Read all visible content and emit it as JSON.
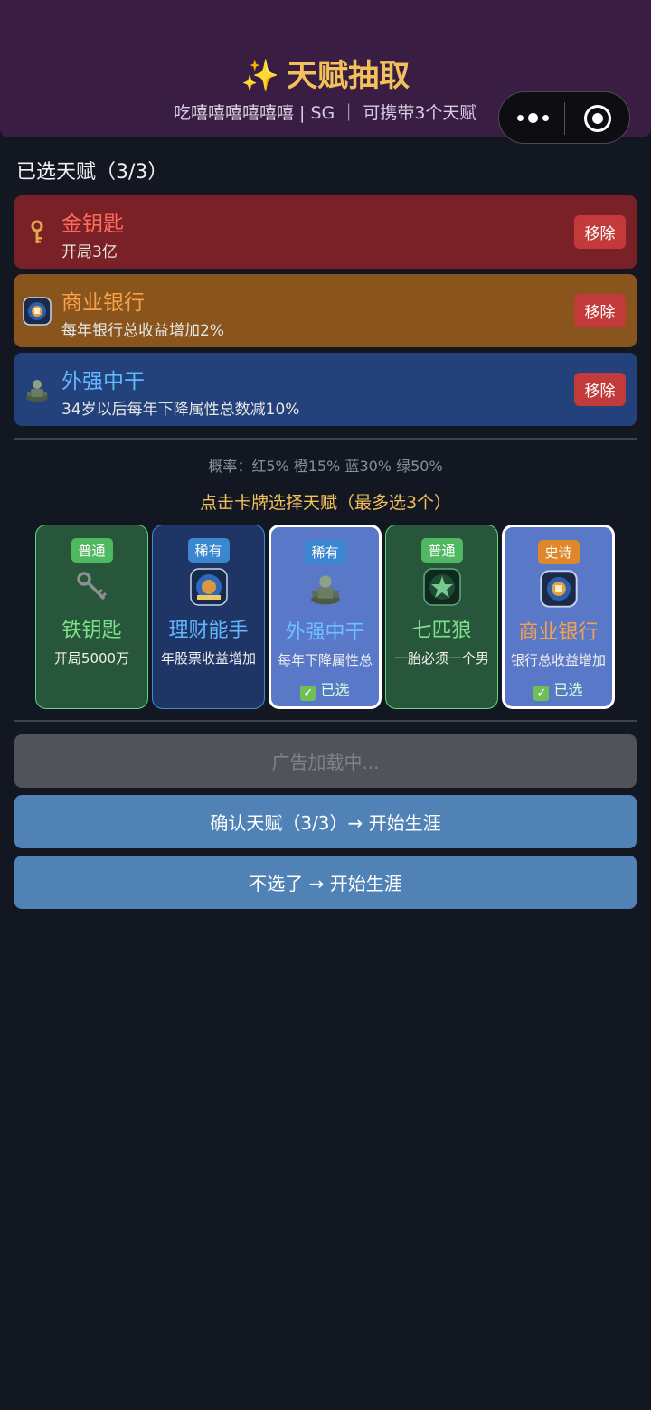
{
  "header": {
    "title_icon": "sparkles-icon",
    "title": "天赋抽取",
    "subtitle": "吃嘻嘻嘻嘻嘻嘻 | SG ｜ 可携带3个天赋",
    "colors": {
      "bg": "#3a1d42",
      "title": "#f2c15a"
    }
  },
  "selected": {
    "title": "已选天赋（3/3）",
    "items": [
      {
        "name": "金钥匙",
        "desc": "开局3亿",
        "icon": "gold-key-icon",
        "remove": "移除",
        "name_color": "#ff6a5a",
        "bg": "#7a2128"
      },
      {
        "name": "商业银行",
        "desc": "每年银行总收益增加2%",
        "icon": "bank-icon",
        "remove": "移除",
        "name_color": "#f7a14a",
        "bg": "#8a551c"
      },
      {
        "name": "外强中干",
        "desc": "34岁以后每年下降属性总数减10%",
        "icon": "statue-icon",
        "remove": "移除",
        "name_color": "#62b6ff",
        "bg": "#23417a"
      }
    ]
  },
  "probability": "概率：红5% 橙15% 蓝30% 绿50%",
  "instruction": "点击卡牌选择天赋（最多选3个）",
  "cards": [
    {
      "rarity": "普通",
      "name": "铁钥匙",
      "desc": "开局5000万",
      "icon": "iron-key-icon",
      "selected": ""
    },
    {
      "rarity": "稀有",
      "name": "理财能手",
      "desc": "年股票收益增加",
      "icon": "finance-icon",
      "selected": ""
    },
    {
      "rarity": "稀有",
      "name": "外强中干",
      "desc": "每年下降属性总",
      "icon": "statue-icon",
      "selected": "已选"
    },
    {
      "rarity": "普通",
      "name": "七匹狼",
      "desc": "一胎必须一个男",
      "icon": "wolf-icon",
      "selected": ""
    },
    {
      "rarity": "史诗",
      "name": "商业银行",
      "desc": "银行总收益增加",
      "icon": "bank-icon",
      "selected": "已选"
    }
  ],
  "buttons": {
    "ad": "广告加载中...",
    "confirm": "确认天赋（3/3）→ 开始生涯",
    "skip": "不选了 → 开始生涯"
  }
}
